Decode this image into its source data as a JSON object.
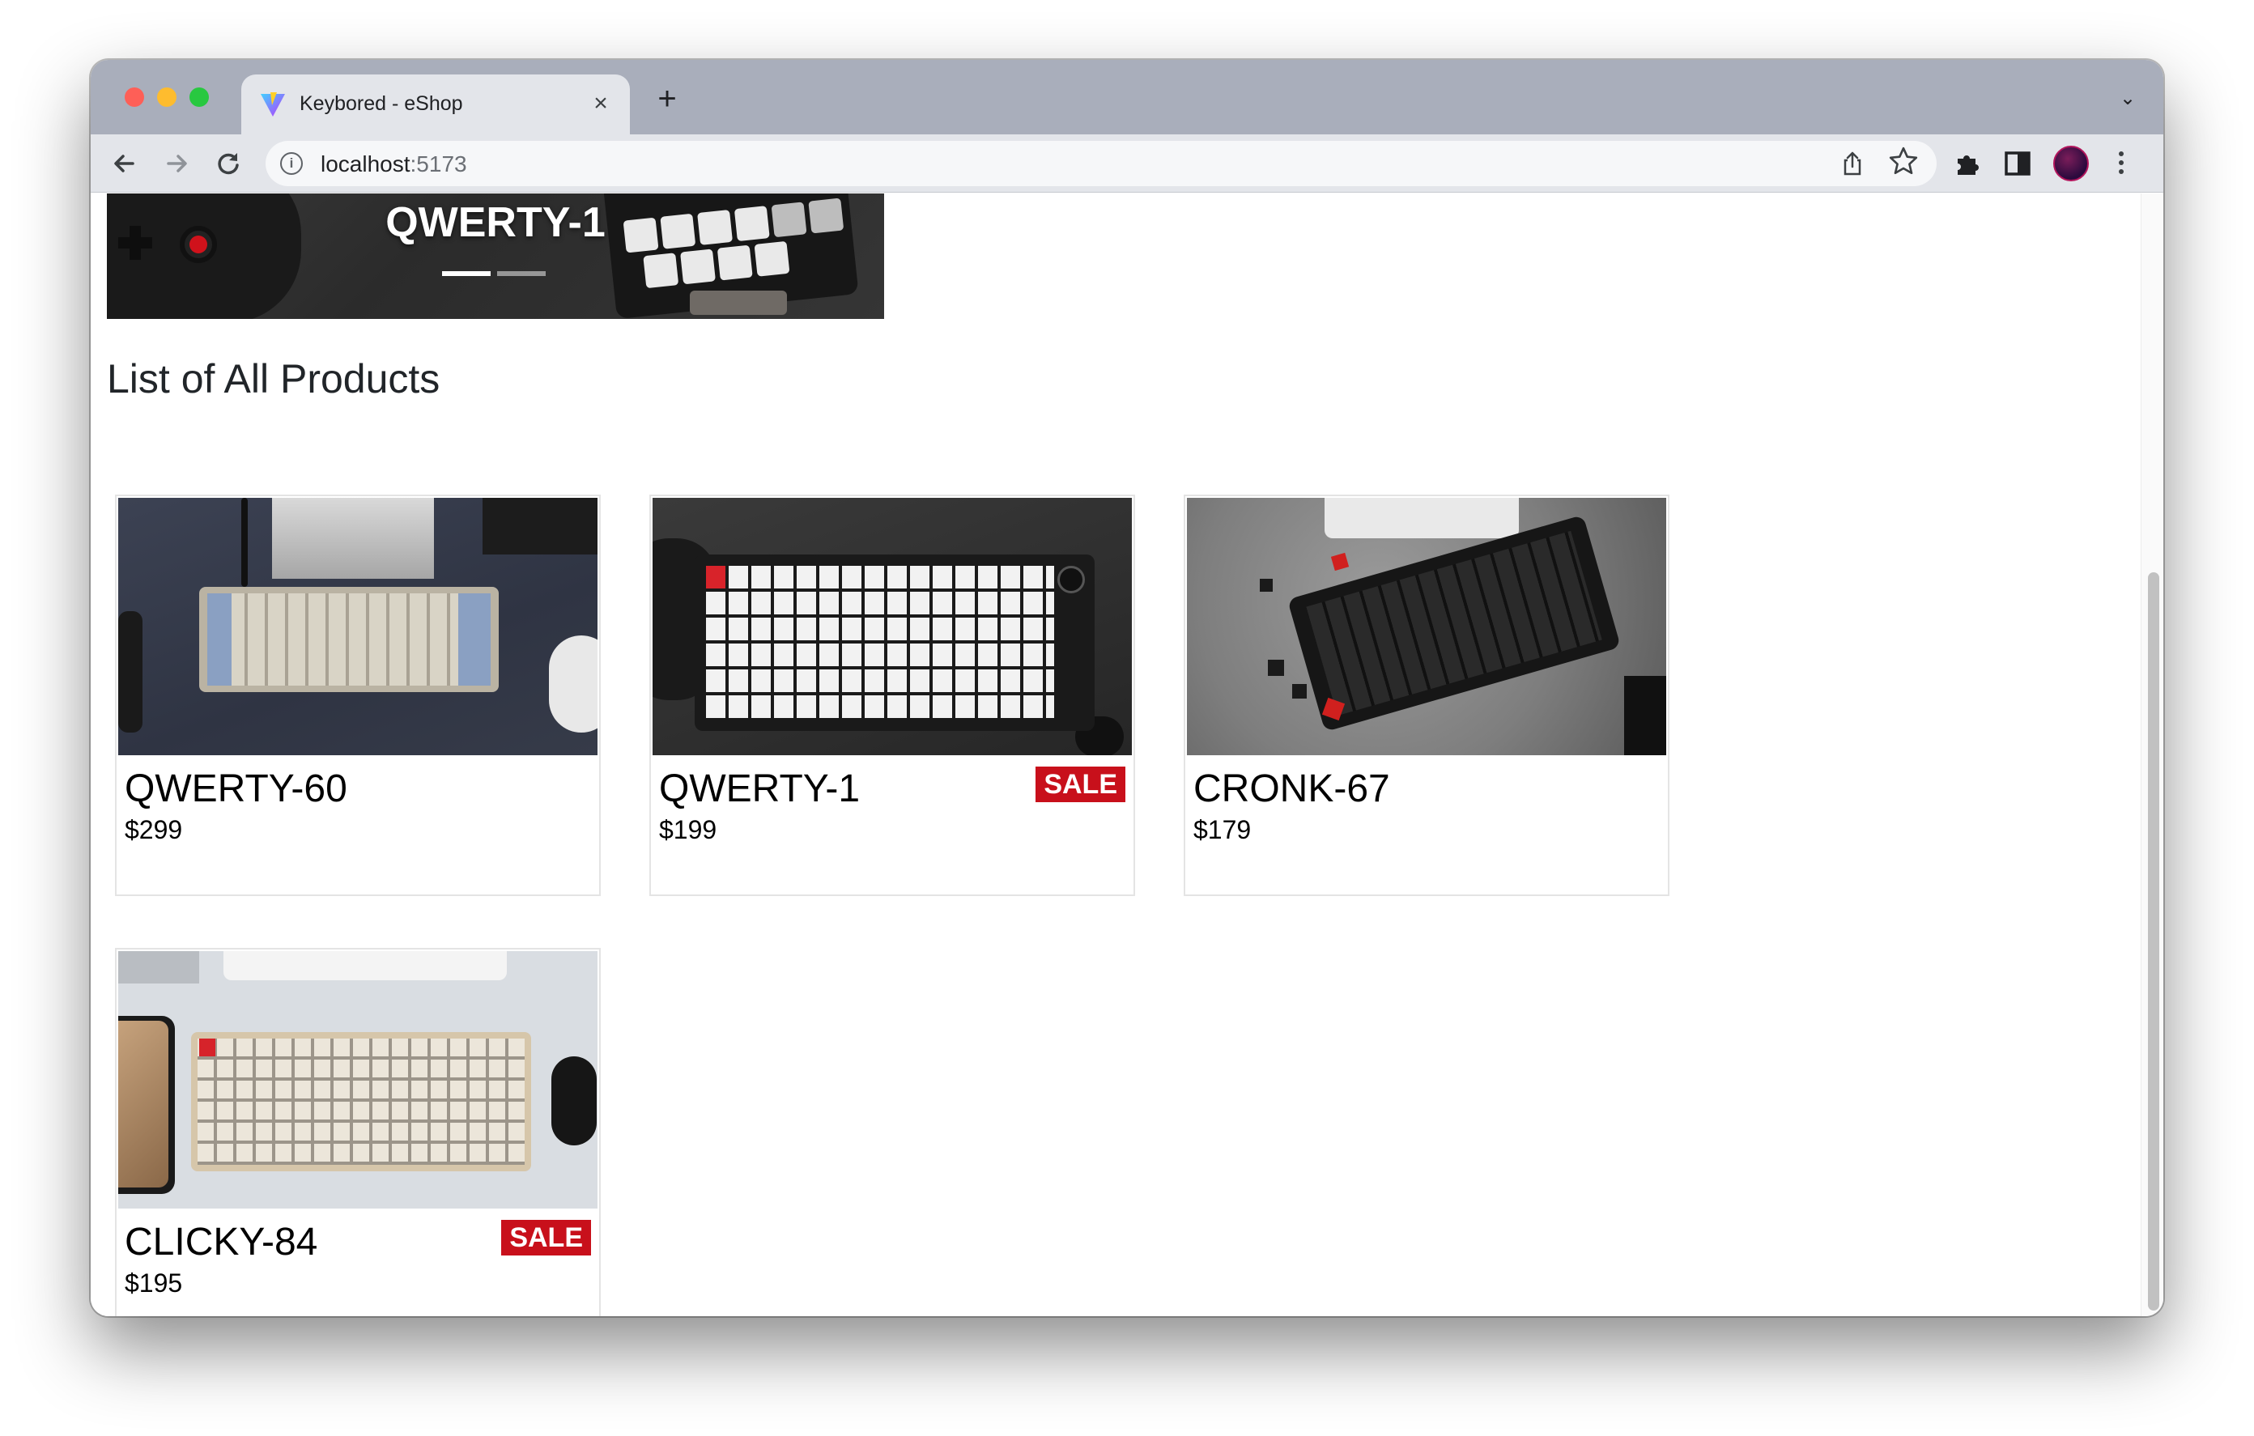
{
  "browser": {
    "tab_title": "Keybored - eShop",
    "tab_close": "×",
    "new_tab": "+",
    "tab_search": "⌄",
    "url_host": "localhost",
    "url_port": ":5173"
  },
  "hero": {
    "title": "QWERTY-1",
    "slide_count": 2,
    "active_slide": 1
  },
  "page": {
    "section_title": "List of All Products"
  },
  "products": [
    {
      "name": "QWERTY-60",
      "price": "$299",
      "sale": false,
      "sale_label": ""
    },
    {
      "name": "QWERTY-1",
      "price": "$199",
      "sale": true,
      "sale_label": "SALE"
    },
    {
      "name": "CRONK-67",
      "price": "$179",
      "sale": false,
      "sale_label": ""
    },
    {
      "name": "CLICKY-84",
      "price": "$195",
      "sale": true,
      "sale_label": "SALE"
    }
  ],
  "colors": {
    "sale_badge": "#c8101b",
    "tabstrip": "#a9aebb",
    "toolbar": "#e3e5ea"
  },
  "icons": [
    "back-arrow-icon",
    "forward-arrow-icon",
    "reload-icon",
    "info-icon",
    "share-icon",
    "star-icon",
    "extensions-icon",
    "side-panel-icon",
    "profile-avatar",
    "more-menu-icon",
    "vite-favicon"
  ]
}
